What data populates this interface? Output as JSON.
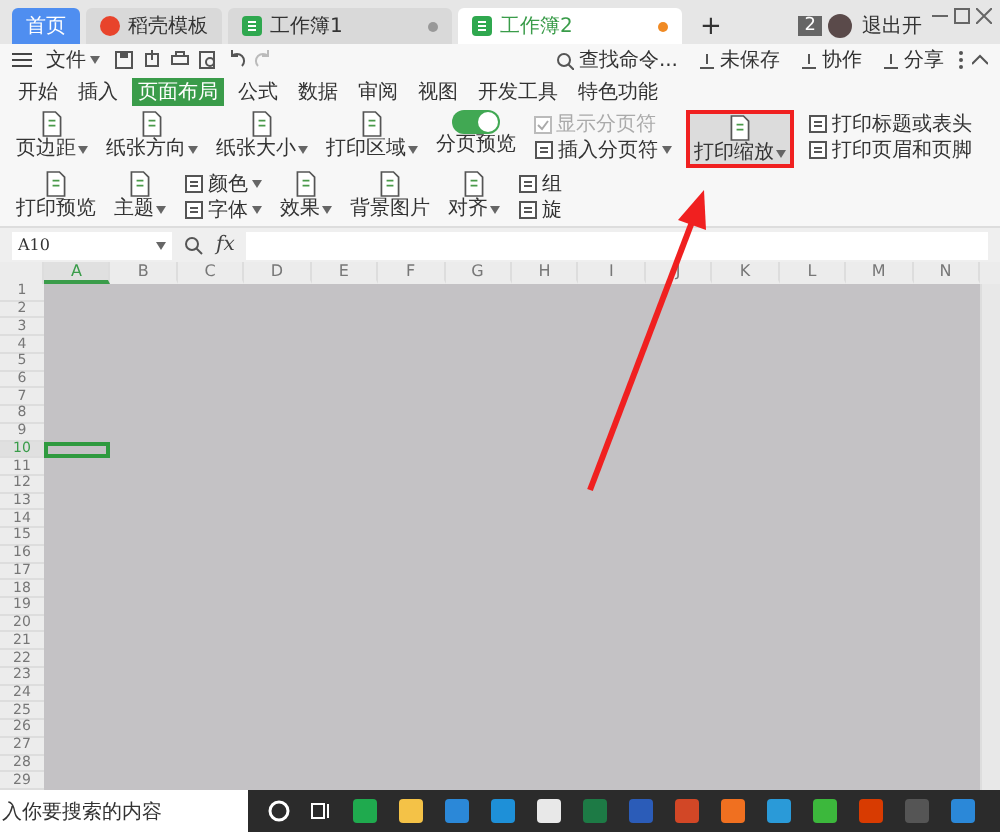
{
  "tabs": [
    {
      "label": "首页",
      "kind": "home",
      "selected": false
    },
    {
      "label": "稻壳模板",
      "kind": "docer",
      "selected": false
    },
    {
      "label": "工作簿1",
      "kind": "sheet",
      "selected": false,
      "modified": false
    },
    {
      "label": "工作簿2",
      "kind": "sheet",
      "selected": true,
      "modified": true
    }
  ],
  "new_tab": "+",
  "badge": "2",
  "user": "退出开",
  "toolbar": {
    "file_menu": "文件",
    "search": "查找命令...",
    "actions": [
      "未保存",
      "协作",
      "分享"
    ]
  },
  "ribbon_tabs": [
    {
      "label": "开始",
      "selected": false
    },
    {
      "label": "插入",
      "selected": false
    },
    {
      "label": "页面布局",
      "selected": true
    },
    {
      "label": "公式",
      "selected": false
    },
    {
      "label": "数据",
      "selected": false
    },
    {
      "label": "审阅",
      "selected": false
    },
    {
      "label": "视图",
      "selected": false
    },
    {
      "label": "开发工具",
      "selected": false
    },
    {
      "label": "特色功能",
      "selected": false
    }
  ],
  "ribbon": [
    {
      "kind": "large",
      "label": "页边距",
      "dropdown": true,
      "highlighted": false
    },
    {
      "kind": "large",
      "label": "纸张方向",
      "dropdown": true,
      "highlighted": false
    },
    {
      "kind": "large",
      "label": "纸张大小",
      "dropdown": true,
      "highlighted": false
    },
    {
      "kind": "large",
      "label": "打印区域",
      "dropdown": true,
      "highlighted": false
    },
    {
      "kind": "toggle",
      "label": "分页预览",
      "on": true
    },
    {
      "kind": "stack",
      "items": [
        {
          "kind": "check",
          "label": "显示分页符",
          "checked": true,
          "disabled": true
        },
        {
          "kind": "small",
          "label": "插入分页符",
          "dropdown": true
        }
      ]
    },
    {
      "kind": "large",
      "label": "打印缩放",
      "dropdown": true,
      "highlighted": true
    },
    {
      "kind": "stack",
      "items": [
        {
          "kind": "small",
          "label": "打印标题或表头",
          "dropdown": false
        },
        {
          "kind": "small",
          "label": "打印页眉和页脚",
          "dropdown": false
        }
      ]
    },
    {
      "kind": "large",
      "label": "打印预览",
      "dropdown": false,
      "highlighted": false
    },
    {
      "kind": "large",
      "label": "主题",
      "dropdown": true,
      "highlighted": false
    },
    {
      "kind": "stack",
      "items": [
        {
          "kind": "small",
          "label": "颜色",
          "dropdown": true
        },
        {
          "kind": "small",
          "label": "字体",
          "dropdown": true
        }
      ]
    },
    {
      "kind": "large",
      "label": "效果",
      "dropdown": true,
      "highlighted": false
    },
    {
      "kind": "large",
      "label": "背景图片",
      "dropdown": false,
      "highlighted": false
    },
    {
      "kind": "large",
      "label": "对齐",
      "dropdown": true,
      "highlighted": false
    },
    {
      "kind": "stack",
      "items": [
        {
          "kind": "small",
          "label": "组",
          "dropdown": false
        },
        {
          "kind": "small",
          "label": "旋",
          "dropdown": false
        }
      ]
    }
  ],
  "formula_bar": {
    "name_box": "A10",
    "fx": "fx"
  },
  "columns": [
    {
      "label": "A",
      "selected": true
    },
    {
      "label": "B",
      "selected": false
    },
    {
      "label": "C",
      "selected": false
    },
    {
      "label": "D",
      "selected": false
    },
    {
      "label": "E",
      "selected": false
    },
    {
      "label": "F",
      "selected": false
    },
    {
      "label": "G",
      "selected": false
    },
    {
      "label": "H",
      "selected": false
    },
    {
      "label": "I",
      "selected": false
    },
    {
      "label": "J",
      "selected": false
    },
    {
      "label": "K",
      "selected": false
    },
    {
      "label": "L",
      "selected": false
    },
    {
      "label": "M",
      "selected": false
    },
    {
      "label": "N",
      "selected": false
    }
  ],
  "rows": [
    {
      "label": "1",
      "selected": false
    },
    {
      "label": "2",
      "selected": false
    },
    {
      "label": "3",
      "selected": false
    },
    {
      "label": "4",
      "selected": false
    },
    {
      "label": "5",
      "selected": false
    },
    {
      "label": "6",
      "selected": false
    },
    {
      "label": "7",
      "selected": false
    },
    {
      "label": "8",
      "selected": false
    },
    {
      "label": "9",
      "selected": false
    },
    {
      "label": "10",
      "selected": true
    },
    {
      "label": "11",
      "selected": false
    },
    {
      "label": "12",
      "selected": false
    },
    {
      "label": "13",
      "selected": false
    },
    {
      "label": "14",
      "selected": false
    },
    {
      "label": "15",
      "selected": false
    },
    {
      "label": "16",
      "selected": false
    },
    {
      "label": "17",
      "selected": false
    },
    {
      "label": "18",
      "selected": false
    },
    {
      "label": "19",
      "selected": false
    },
    {
      "label": "20",
      "selected": false
    },
    {
      "label": "21",
      "selected": false
    },
    {
      "label": "22",
      "selected": false
    },
    {
      "label": "23",
      "selected": false
    },
    {
      "label": "24",
      "selected": false
    },
    {
      "label": "25",
      "selected": false
    },
    {
      "label": "26",
      "selected": false
    },
    {
      "label": "27",
      "selected": false
    },
    {
      "label": "28",
      "selected": false
    },
    {
      "label": "29",
      "selected": false
    }
  ],
  "taskbar": {
    "search_placeholder": "入你要搜索的内容"
  }
}
